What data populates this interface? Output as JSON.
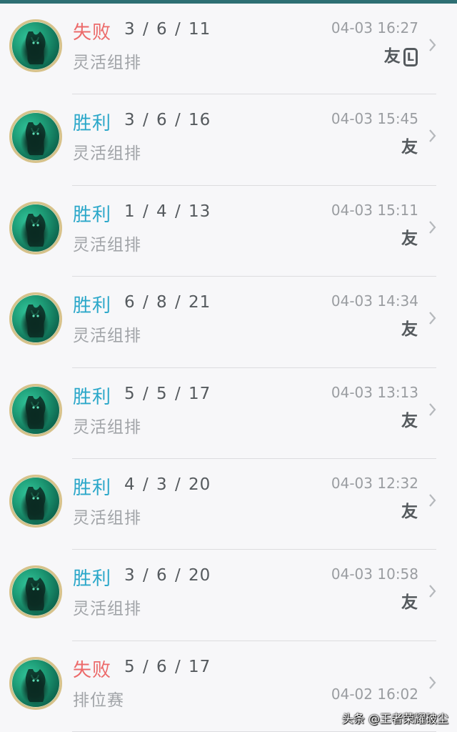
{
  "colors": {
    "top_bar": "#2e6f74",
    "win": "#2aa7c9",
    "lose": "#ec6a6a",
    "text_dark": "#555a5e",
    "text_light": "#a1a4a8"
  },
  "matches": [
    {
      "result": "失败",
      "outcome": "lose",
      "kda": "3 / 6 / 11",
      "mode": "灵活组排",
      "time": "04-03 16:27",
      "badges": [
        "友",
        "L"
      ]
    },
    {
      "result": "胜利",
      "outcome": "win",
      "kda": "3 / 6 / 16",
      "mode": "灵活组排",
      "time": "04-03 15:45",
      "badges": [
        "友"
      ]
    },
    {
      "result": "胜利",
      "outcome": "win",
      "kda": "1 / 4 / 13",
      "mode": "灵活组排",
      "time": "04-03 15:11",
      "badges": [
        "友"
      ]
    },
    {
      "result": "胜利",
      "outcome": "win",
      "kda": "6 / 8 / 21",
      "mode": "灵活组排",
      "time": "04-03 14:34",
      "badges": [
        "友"
      ]
    },
    {
      "result": "胜利",
      "outcome": "win",
      "kda": "5 / 5 / 17",
      "mode": "灵活组排",
      "time": "04-03 13:13",
      "badges": [
        "友"
      ]
    },
    {
      "result": "胜利",
      "outcome": "win",
      "kda": "4 / 3 / 20",
      "mode": "灵活组排",
      "time": "04-03 12:32",
      "badges": [
        "友"
      ]
    },
    {
      "result": "胜利",
      "outcome": "win",
      "kda": "3 / 6 / 20",
      "mode": "灵活组排",
      "time": "04-03 10:58",
      "badges": [
        "友"
      ]
    },
    {
      "result": "失败",
      "outcome": "lose",
      "kda": "5 / 6 / 17",
      "mode": "排位赛",
      "time": "04-02 16:02",
      "badges": []
    }
  ],
  "icons": {
    "avatar": "hero-avatar-icon",
    "chevron": "chevron-right-icon"
  },
  "watermark": "头条 @王者荣耀破尘"
}
